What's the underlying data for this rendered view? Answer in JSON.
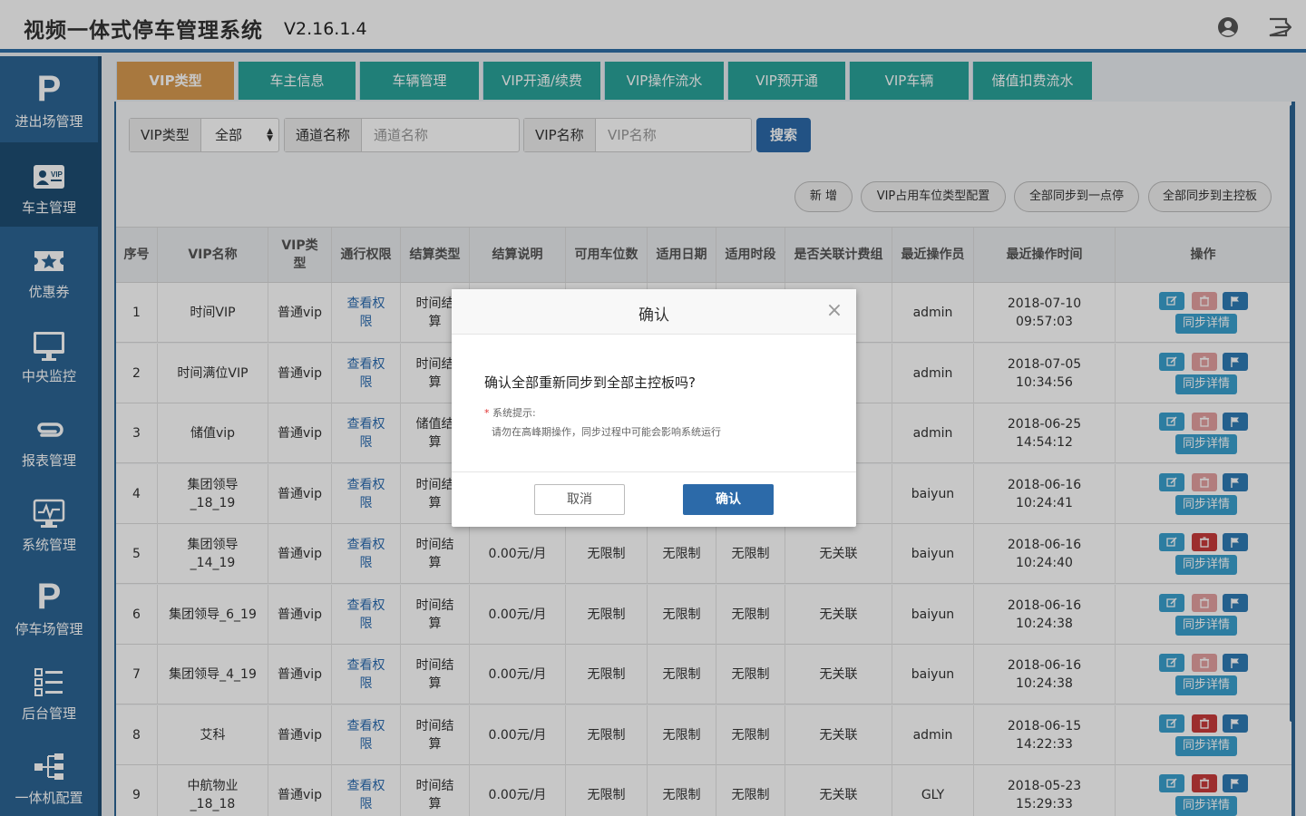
{
  "header": {
    "title": "视频一体式停车管理系统",
    "version": "V2.16.1.4"
  },
  "sidebar": {
    "items": [
      {
        "label": "进出场管理",
        "icon": "parking-p-icon",
        "logo": "P"
      },
      {
        "label": "车主管理",
        "icon": "vip-card-icon",
        "active": true
      },
      {
        "label": "优惠券",
        "icon": "coupon-star-icon"
      },
      {
        "label": "中央监控",
        "icon": "monitor-icon"
      },
      {
        "label": "报表管理",
        "icon": "paperclip-icon"
      },
      {
        "label": "系统管理",
        "icon": "system-monitor-icon"
      },
      {
        "label": "停车场管理",
        "icon": "parking-p-icon",
        "logo": "P"
      },
      {
        "label": "后台管理",
        "icon": "list-icon"
      },
      {
        "label": "一体机配置",
        "icon": "sitemap-icon"
      }
    ]
  },
  "tabs": [
    "VIP类型",
    "车主信息",
    "车辆管理",
    "VIP开通/续费",
    "VIP操作流水",
    "VIP预开通",
    "VIP车辆",
    "储值扣费流水"
  ],
  "filters": {
    "vip_type_label": "VIP类型",
    "vip_type_value": "全部",
    "channel_label": "通道名称",
    "channel_placeholder": "通道名称",
    "vip_name_label": "VIP名称",
    "vip_name_placeholder": "VIP名称",
    "search": "搜索"
  },
  "actions": [
    "新 增",
    "VIP占用车位类型配置",
    "全部同步到一点停",
    "全部同步到主控板"
  ],
  "table": {
    "headers": [
      "序号",
      "VIP名称",
      "VIP类型",
      "通行权限",
      "结算类型",
      "结算说明",
      "可用车位数",
      "适用日期",
      "适用时段",
      "是否关联计费组",
      "最近操作员",
      "最近操作时间",
      "操作"
    ],
    "sync_label": "同步详情",
    "rows": [
      {
        "no": "1",
        "name": "时间VIP",
        "type": "普通vip",
        "perm": "查看权限",
        "settle": "时间结算",
        "desc": "",
        "spots": "",
        "date": "",
        "period": "",
        "assoc": "",
        "op": "admin",
        "time": "2018-07-10 09:57:03",
        "del_strong": false
      },
      {
        "no": "2",
        "name": "时间满位VIP",
        "type": "普通vip",
        "perm": "查看权限",
        "settle": "时间结算",
        "desc": "",
        "spots": "",
        "date": "",
        "period": "",
        "assoc": "",
        "op": "admin",
        "time": "2018-07-05 10:34:56",
        "del_strong": false
      },
      {
        "no": "3",
        "name": "储值vip",
        "type": "普通vip",
        "perm": "查看权限",
        "settle": "储值结算",
        "desc": "",
        "spots": "",
        "date": "",
        "period": "",
        "assoc": "",
        "op": "admin",
        "time": "2018-06-25 14:54:12",
        "del_strong": false
      },
      {
        "no": "4",
        "name": "集团领导_18_19",
        "type": "普通vip",
        "perm": "查看权限",
        "settle": "时间结算",
        "desc": "",
        "spots": "",
        "date": "",
        "period": "",
        "assoc": "",
        "op": "baiyun",
        "time": "2018-06-16 10:24:41",
        "del_strong": false
      },
      {
        "no": "5",
        "name": "集团领导_14_19",
        "type": "普通vip",
        "perm": "查看权限",
        "settle": "时间结算",
        "desc": "0.00元/月",
        "spots": "无限制",
        "date": "无限制",
        "period": "无限制",
        "assoc": "无关联",
        "op": "baiyun",
        "time": "2018-06-16 10:24:40",
        "del_strong": true
      },
      {
        "no": "6",
        "name": "集团领导_6_19",
        "type": "普通vip",
        "perm": "查看权限",
        "settle": "时间结算",
        "desc": "0.00元/月",
        "spots": "无限制",
        "date": "无限制",
        "period": "无限制",
        "assoc": "无关联",
        "op": "baiyun",
        "time": "2018-06-16 10:24:38",
        "del_strong": false
      },
      {
        "no": "7",
        "name": "集团领导_4_19",
        "type": "普通vip",
        "perm": "查看权限",
        "settle": "时间结算",
        "desc": "0.00元/月",
        "spots": "无限制",
        "date": "无限制",
        "period": "无限制",
        "assoc": "无关联",
        "op": "baiyun",
        "time": "2018-06-16 10:24:38",
        "del_strong": false
      },
      {
        "no": "8",
        "name": "艾科",
        "type": "普通vip",
        "perm": "查看权限",
        "settle": "时间结算",
        "desc": "0.00元/月",
        "spots": "无限制",
        "date": "无限制",
        "period": "无限制",
        "assoc": "无关联",
        "op": "admin",
        "time": "2018-06-15 14:22:33",
        "del_strong": true
      },
      {
        "no": "9",
        "name": "中航物业_18_18",
        "type": "普通vip",
        "perm": "查看权限",
        "settle": "时间结算",
        "desc": "0.00元/月",
        "spots": "无限制",
        "date": "无限制",
        "period": "无限制",
        "assoc": "无关联",
        "op": "GLY",
        "time": "2018-05-23 15:29:33",
        "del_strong": true
      }
    ]
  },
  "modal": {
    "title": "确认",
    "message": "确认全部重新同步到全部主控板吗?",
    "hint_star": "*",
    "hint_label": "系统提示:",
    "note": "请勿在高峰期操作，同步过程中可能会影响系统运行",
    "cancel": "取消",
    "confirm": "确认"
  },
  "colors": {
    "primary": "#2c6594",
    "tab": "#2aa39a",
    "tab_active": "#d89a50",
    "button": "#2c6aa9",
    "link": "#2a6bb0"
  }
}
